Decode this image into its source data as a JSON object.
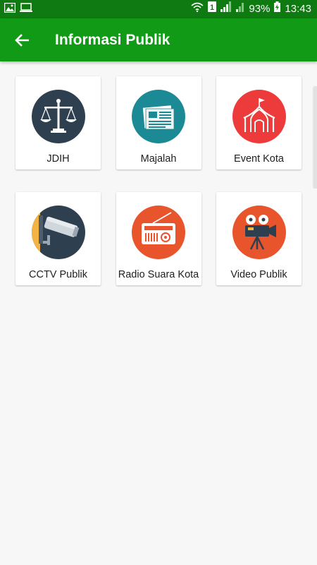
{
  "status_bar": {
    "battery_percent": "93%",
    "time": "13:43",
    "sim_slot": "1",
    "left_icons": [
      "gallery-icon",
      "screen-cast-icon"
    ],
    "right_icons": [
      "wifi-icon",
      "sim-icon",
      "signal-icon",
      "battery-charging-icon"
    ]
  },
  "app_bar": {
    "title": "Informasi Publik",
    "back_icon": "arrow-back-icon",
    "color": "#109a15"
  },
  "menu": {
    "items": [
      {
        "label": "JDIH",
        "icon": "scales-of-justice-icon",
        "color": "#2e3f4f"
      },
      {
        "label": "Majalah",
        "icon": "newspaper-icon",
        "color": "#1b8a94"
      },
      {
        "label": "Event Kota",
        "icon": "circus-tent-icon",
        "color": "#ed3b3b"
      },
      {
        "label": "CCTV Publik",
        "icon": "cctv-camera-icon",
        "color": "#2e3f4f"
      },
      {
        "label": "Radio Suara Kota",
        "icon": "radio-icon",
        "color": "#e8552c"
      },
      {
        "label": "Video Publik",
        "icon": "film-camera-icon",
        "color": "#e8552c"
      }
    ]
  }
}
